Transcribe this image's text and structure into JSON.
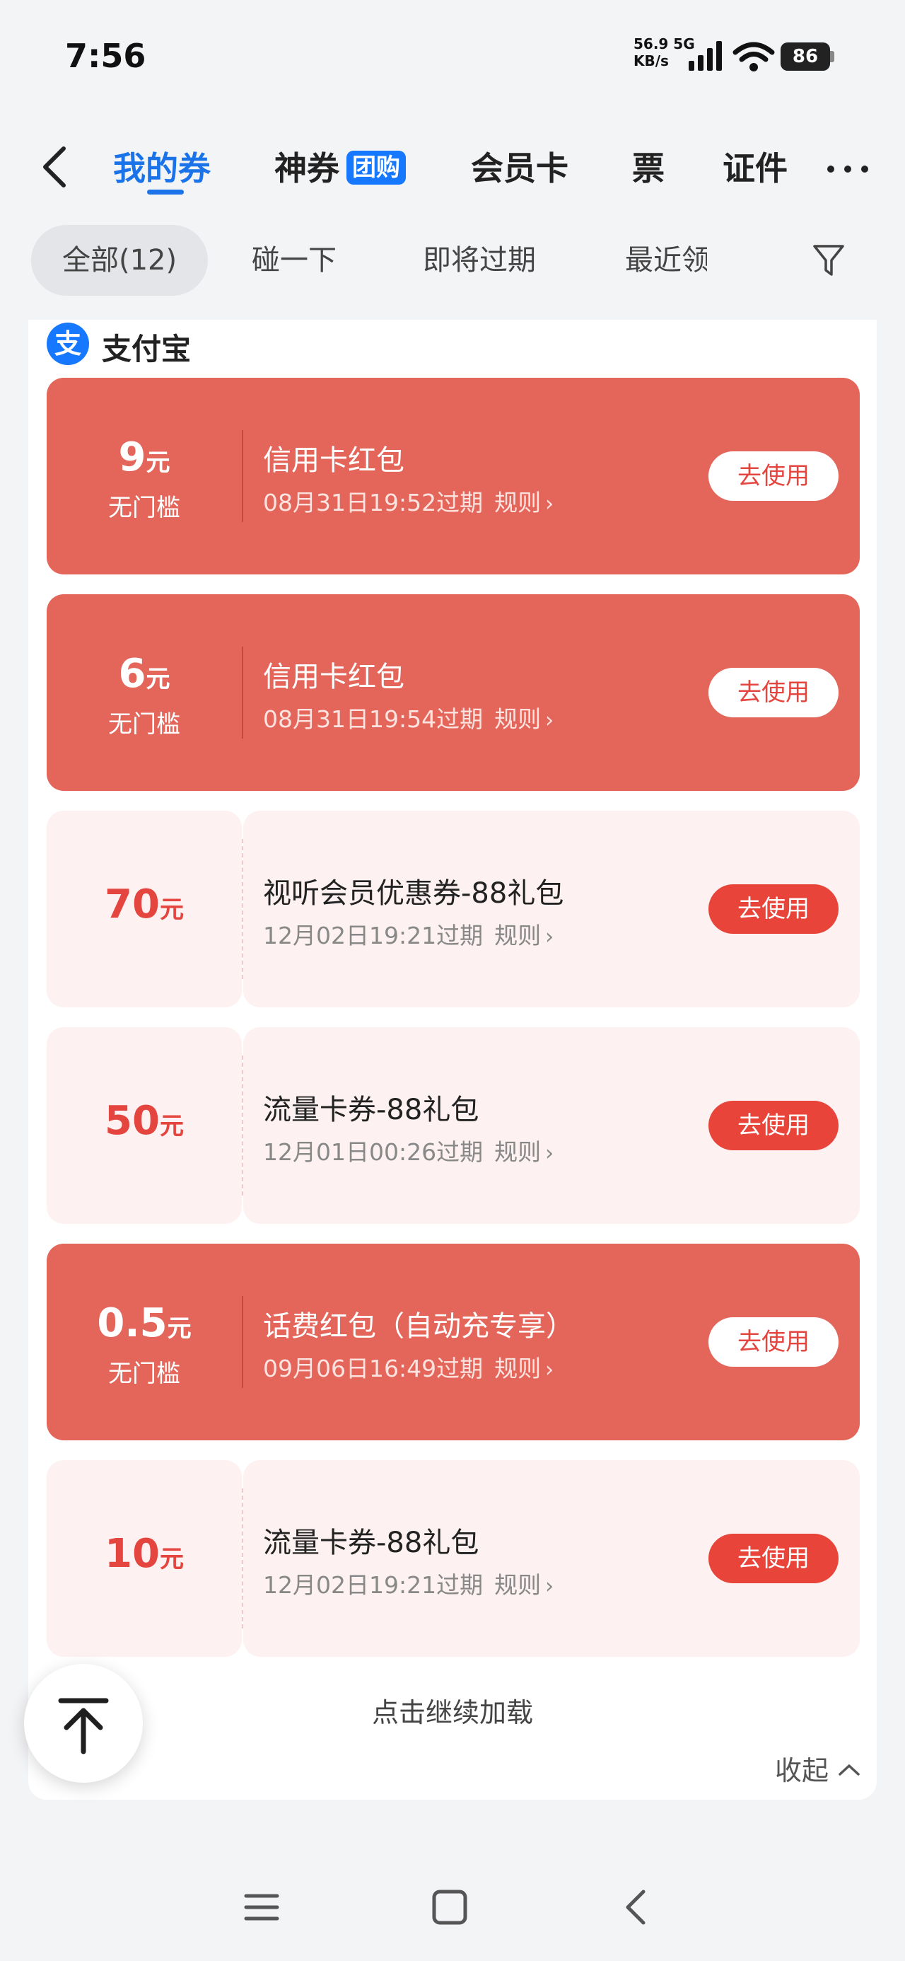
{
  "status": {
    "time": "7:56",
    "speed_value": "56.9 5G",
    "speed_unit": "KB/s",
    "battery": "86"
  },
  "nav": {
    "tabs": [
      {
        "label": "我的券"
      },
      {
        "label": "神券",
        "badge": "团购"
      },
      {
        "label": "会员卡"
      },
      {
        "label": "票"
      },
      {
        "label": "证件"
      }
    ]
  },
  "filters": [
    {
      "label": "全部(12)"
    },
    {
      "label": "碰一下"
    },
    {
      "label": "即将过期"
    },
    {
      "label": "最近领"
    }
  ],
  "provider": {
    "logo_char": "支",
    "name": "支付宝"
  },
  "coupons": [
    {
      "style": "red",
      "amount": "9",
      "unit": "元",
      "threshold": "无门槛",
      "title": "信用卡红包",
      "expiry": "08月31日19:52过期",
      "rule": "规则",
      "button": "去使用"
    },
    {
      "style": "red",
      "amount": "6",
      "unit": "元",
      "threshold": "无门槛",
      "title": "信用卡红包",
      "expiry": "08月31日19:54过期",
      "rule": "规则",
      "button": "去使用"
    },
    {
      "style": "pink",
      "amount": "70",
      "unit": "元",
      "threshold": "",
      "title": "视听会员优惠券-88礼包",
      "expiry": "12月02日19:21过期",
      "rule": "规则",
      "button": "去使用"
    },
    {
      "style": "pink",
      "amount": "50",
      "unit": "元",
      "threshold": "",
      "title": "流量卡券-88礼包",
      "expiry": "12月01日00:26过期",
      "rule": "规则",
      "button": "去使用"
    },
    {
      "style": "red",
      "amount": "0.5",
      "unit": "元",
      "threshold": "无门槛",
      "title": "话费红包（自动充专享）",
      "expiry": "09月06日16:49过期",
      "rule": "规则",
      "button": "去使用"
    },
    {
      "style": "pink",
      "amount": "10",
      "unit": "元",
      "threshold": "",
      "title": "流量卡券-88礼包",
      "expiry": "12月02日19:21过期",
      "rule": "规则",
      "button": "去使用"
    }
  ],
  "footer": {
    "load_more": "点击继续加载",
    "collapse": "收起"
  },
  "icons": {
    "back": "back-arrow-icon",
    "more": "more-dots-icon",
    "filter": "filter-funnel-icon",
    "to_top": "back-to-top-icon"
  },
  "colors": {
    "accent_blue": "#1a73e8",
    "coupon_red": "#e4655a",
    "coupon_pink": "#fdf1f1",
    "button_red": "#e8443a"
  }
}
